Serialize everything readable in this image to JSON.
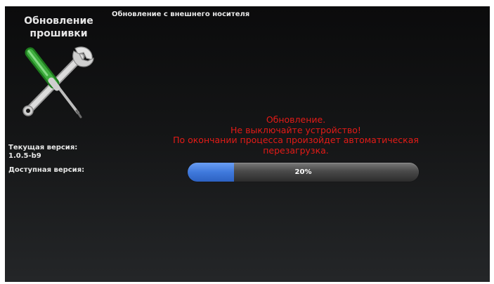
{
  "sidebar": {
    "title_line1": "Обновление",
    "title_line2": "прошивки",
    "icon": "tools-icon"
  },
  "header": {
    "source_title": "Обновление с внешнего носителя"
  },
  "versions": {
    "current_label": "Текущая версия:",
    "current_value": "1.0.5-b9",
    "available_label": "Доступная версия:"
  },
  "message": {
    "line1": "Обновление.",
    "line2": "Не выключайте устройство!",
    "line3": "По окончании процесса произойдет автоматическая",
    "line4": "перезагрузка."
  },
  "progress": {
    "percent": 20,
    "label": "20%",
    "fill_color": "#3f79dc"
  },
  "colors": {
    "background": "#141516",
    "message": "#e41b17",
    "text": "#e8e8e8"
  }
}
